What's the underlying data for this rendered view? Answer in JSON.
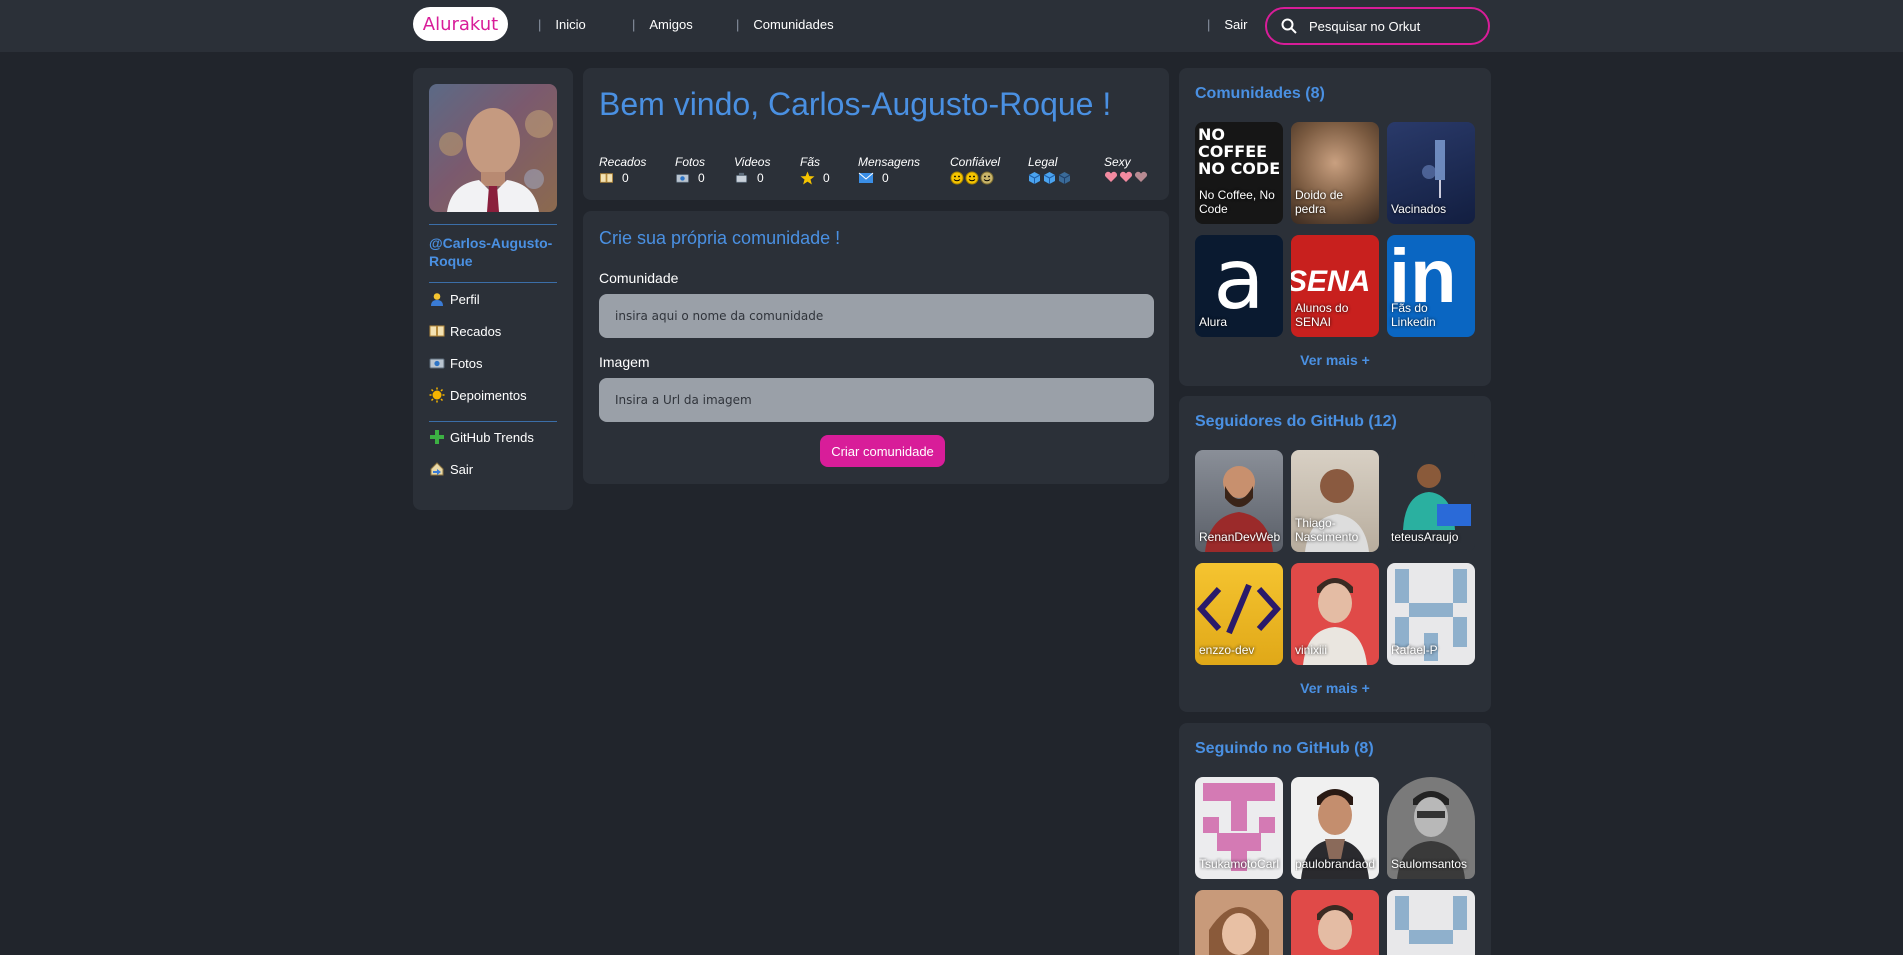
{
  "header": {
    "logo": "Alurakut",
    "nav": [
      "Inicio",
      "Amigos",
      "Comunidades"
    ],
    "logout": "Sair",
    "search_placeholder": "Pesquisar no Orkut"
  },
  "sidebar": {
    "username": "@Carlos-Augusto-Roque",
    "items": [
      {
        "label": "Perfil",
        "icon": "user-icon"
      },
      {
        "label": "Recados",
        "icon": "book-icon"
      },
      {
        "label": "Fotos",
        "icon": "camera-icon"
      },
      {
        "label": "Depoimentos",
        "icon": "sun-icon"
      }
    ],
    "items2": [
      {
        "label": "GitHub Trends",
        "icon": "plus-icon"
      },
      {
        "label": "Sair",
        "icon": "logout-icon"
      }
    ]
  },
  "welcome": {
    "title": "Bem vindo, Carlos-Augusto-Roque !",
    "stats": [
      {
        "label": "Recados",
        "value": "0",
        "icon": "book-icon"
      },
      {
        "label": "Fotos",
        "value": "0",
        "icon": "camera-icon"
      },
      {
        "label": "Videos",
        "value": "0",
        "icon": "video-icon"
      },
      {
        "label": "Fãs",
        "value": "0",
        "icon": "star-icon"
      },
      {
        "label": "Mensagens",
        "value": "0",
        "icon": "mail-icon"
      },
      {
        "label": "Confiável",
        "icon": "smiley-icon"
      },
      {
        "label": "Legal",
        "icon": "cube-icon"
      },
      {
        "label": "Sexy",
        "icon": "heart-icon"
      }
    ]
  },
  "form": {
    "title": "Crie sua própria comunidade !",
    "community_label": "Comunidade",
    "community_placeholder": "insira aqui o nome da comunidade",
    "image_label": "Imagem",
    "image_placeholder": "Insira a Url da imagem",
    "submit": "Criar comunidade"
  },
  "communities": {
    "title": "Comunidades (8)",
    "items": [
      "No Coffee, No Code",
      "Doido de pedra",
      "Vacinados",
      "Alura",
      "Alunos do SENAI",
      "Fãs do Linkedin"
    ],
    "image_text": [
      "NO COFFEE NO CODE",
      "a",
      "SENA",
      "in"
    ],
    "more": "Ver mais +"
  },
  "followers": {
    "title": "Seguidores do GitHub (12)",
    "items": [
      "RenanDevWeb",
      "Thiago-Nascimento",
      "teteusAraujo",
      "enzzo-dev",
      "vinixiii",
      "Rafael-P"
    ],
    "more": "Ver mais +"
  },
  "following": {
    "title": "Seguindo no GitHub (8)",
    "items": [
      "TsukamotoCarl",
      "paulobrandaod",
      "Saulomsantos"
    ]
  },
  "colors": {
    "accent": "#d81d99",
    "link": "#4a90e2",
    "background": "#21252c",
    "panel": "#2b3038"
  }
}
